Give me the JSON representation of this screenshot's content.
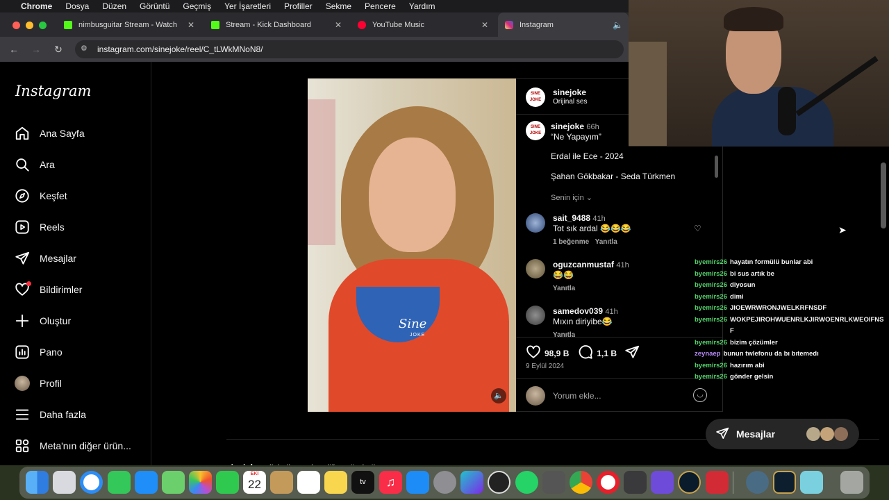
{
  "menubar": {
    "app": "Chrome",
    "items": [
      "Dosya",
      "Düzen",
      "Görüntü",
      "Geçmiş",
      "Yer İşaretleri",
      "Profiller",
      "Sekme",
      "Pencere",
      "Yardım"
    ]
  },
  "tabs": [
    {
      "label": "nimbusguitar Stream - Watch"
    },
    {
      "label": "Stream - Kick Dashboard"
    },
    {
      "label": "YouTube Music"
    },
    {
      "label": "Instagram"
    }
  ],
  "address": {
    "url": "instagram.com/sinejoke/reel/C_tLWkMNoN8/"
  },
  "instagram": {
    "logo": "Instagram",
    "nav": [
      {
        "label": "Ana Sayfa",
        "icon": "home-icon"
      },
      {
        "label": "Ara",
        "icon": "search-icon"
      },
      {
        "label": "Keşfet",
        "icon": "compass-icon"
      },
      {
        "label": "Reels",
        "icon": "reels-icon"
      },
      {
        "label": "Mesajlar",
        "icon": "send-icon"
      },
      {
        "label": "Bildirimler",
        "icon": "heart-icon"
      },
      {
        "label": "Oluştur",
        "icon": "plus-icon"
      },
      {
        "label": "Pano",
        "icon": "dashboard-icon"
      },
      {
        "label": "Profil",
        "icon": "profile-avatar"
      },
      {
        "label": "Daha fazla",
        "icon": "menu-icon"
      },
      {
        "label": "Meta'nın diğer ürün...",
        "icon": "apps-icon"
      }
    ],
    "post": {
      "author": "sinejoke",
      "audio": "Orijinal ses",
      "avatar_text": "SINE JOKE",
      "video_watermark": "Sine",
      "video_watermark_sub": "JOKE",
      "caption_author": "sinejoke",
      "caption_time": "66h",
      "caption_title": "“Ne Yapayım”",
      "caption_line1": "Erdal ile Ece - 2024",
      "caption_line2": "Şahan Gökbakar - Seda Türkmen",
      "senin_icin": "Senin için",
      "likes": "98,9 B",
      "comments_count": "1,1 B",
      "date": "9 Eylül 2024",
      "add_comment": "Yorum ekle...",
      "more_from": "sinejoke",
      "more_from_suffix": " adlı kullanıcıdan diğer gönderiler"
    },
    "comments": [
      {
        "user": "sait_9488",
        "time": "41h",
        "text": "Tot sık ardal 😂😂😂",
        "likes": "1 beğenme",
        "reply": "Yanıtla"
      },
      {
        "user": "oguzcanmustaf",
        "time": "41h",
        "text": "😂😂",
        "reply": "Yanıtla"
      },
      {
        "user": "samedov039",
        "time": "41h",
        "text": "Mıxın diriyibe😂",
        "reply": "Yanıtla"
      }
    ],
    "messages_bar": {
      "label": "Mesajlar"
    }
  },
  "chat": [
    {
      "user": "byemirs26",
      "text": "hayatın formülü bunlar abi",
      "color": "#53d36b"
    },
    {
      "user": "byemirs26",
      "text": "bi sus artık be",
      "color": "#53d36b"
    },
    {
      "user": "byemirs26",
      "text": "diyosun",
      "color": "#53d36b"
    },
    {
      "user": "byemirs26",
      "text": "dimi",
      "color": "#53d36b"
    },
    {
      "user": "byemirs26",
      "text": "JIOEWRWRONJWELKRFNSDF",
      "color": "#53d36b"
    },
    {
      "user": "byemirs26",
      "text": "WOKPEJIROHWUENRLKJIRWOENRLKWEOIFNSF",
      "color": "#53d36b"
    },
    {
      "user": "byemirs26",
      "text": "bizim çözümler",
      "color": "#53d36b"
    },
    {
      "user": "zeynaep",
      "text": "bunun twlefonu da bı bıtemedı",
      "color": "#b58af5"
    },
    {
      "user": "byemirs26",
      "text": "hazırım abi",
      "color": "#53d36b"
    },
    {
      "user": "byemirs26",
      "text": "gönder gelsin",
      "color": "#53d36b"
    }
  ],
  "dock": {
    "calendar_month": "EKİ",
    "calendar_day": "22",
    "icons": [
      "finder-icon",
      "launchpad-icon",
      "safari-icon",
      "messages-icon",
      "mail-icon",
      "maps-icon",
      "photos-icon",
      "facetime-icon",
      "calendar-icon",
      "notes-icon",
      "reminders-icon",
      "stickies-icon",
      "appletv-icon",
      "music-icon",
      "appstore-icon",
      "settings-icon",
      "canva-icon",
      "obs-icon",
      "whatsapp-icon",
      "gridapp-icon",
      "chrome-icon",
      "opera-icon",
      "calculator-icon",
      "imovie-icon",
      "league-icon",
      "kick-icon",
      "scanner-icon",
      "league2-icon",
      "finder2-icon",
      "trash-icon"
    ]
  }
}
